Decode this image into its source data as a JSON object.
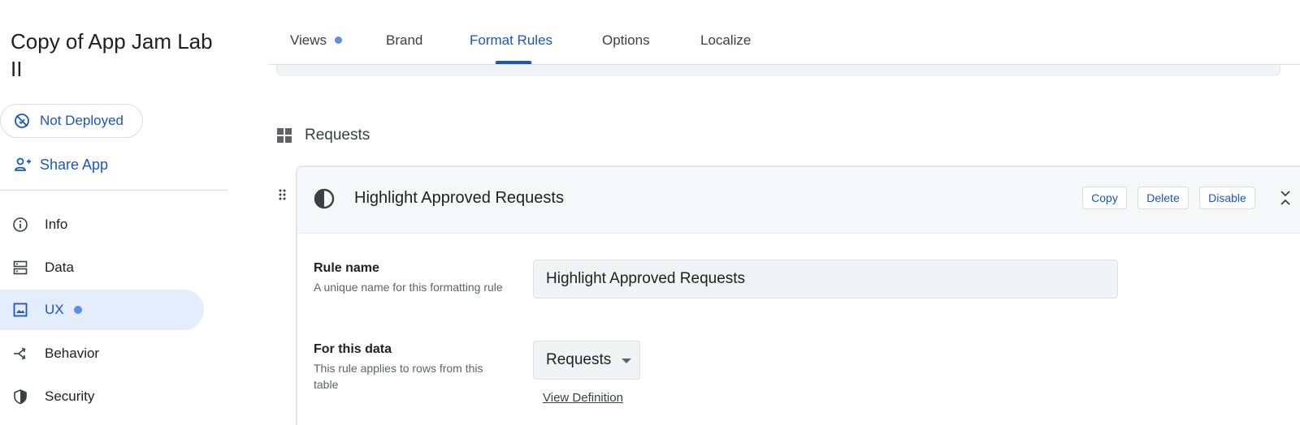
{
  "app": {
    "title": "Copy of App Jam Lab II"
  },
  "sidebar": {
    "deploy_status": "Not Deployed",
    "share_label": "Share App",
    "items": [
      {
        "label": "Info",
        "icon": "info-icon"
      },
      {
        "label": "Data",
        "icon": "data-icon"
      },
      {
        "label": "UX",
        "icon": "image-icon",
        "active": true,
        "has_dot": true
      },
      {
        "label": "Behavior",
        "icon": "behavior-icon"
      },
      {
        "label": "Security",
        "icon": "shield-icon"
      }
    ]
  },
  "tabs": [
    {
      "label": "Views",
      "has_dot": true
    },
    {
      "label": "Brand"
    },
    {
      "label": "Format Rules",
      "active": true
    },
    {
      "label": "Options"
    },
    {
      "label": "Localize"
    }
  ],
  "section": {
    "title": "Requests",
    "icon": "grid-icon"
  },
  "rule": {
    "title": "Highlight Approved Requests",
    "icon": "contrast-icon",
    "buttons": {
      "copy": "Copy",
      "delete": "Delete",
      "disable": "Disable"
    },
    "fields": {
      "rule_name": {
        "label": "Rule name",
        "help": "A unique name for this formatting rule",
        "value": "Highlight Approved Requests"
      },
      "for_this_data": {
        "label": "For this data",
        "help": "This rule applies to rows from this table",
        "value": "Requests",
        "link": "View Definition"
      }
    }
  },
  "colors": {
    "accent": "#1a56c4",
    "active_bg": "#e3edfb",
    "dot": "#5b8def"
  }
}
